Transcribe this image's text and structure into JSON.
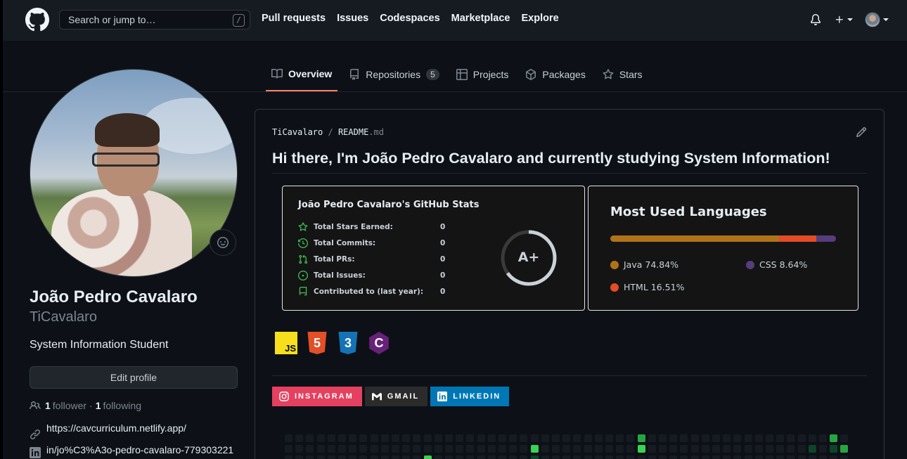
{
  "header": {
    "search_placeholder": "Search or jump to…",
    "search_shortcut": "/",
    "nav": [
      "Pull requests",
      "Issues",
      "Codespaces",
      "Marketplace",
      "Explore"
    ]
  },
  "tabs": [
    {
      "label": "Overview",
      "icon": "book-icon"
    },
    {
      "label": "Repositories",
      "icon": "repo-icon",
      "count": "5"
    },
    {
      "label": "Projects",
      "icon": "table-icon"
    },
    {
      "label": "Packages",
      "icon": "package-icon"
    },
    {
      "label": "Stars",
      "icon": "star-icon"
    }
  ],
  "profile": {
    "name": "João Pedro Cavalaro",
    "login": "TiCavalaro",
    "bio": "System Information Student",
    "edit_label": "Edit profile",
    "followers": "1",
    "followers_label": "follower",
    "separator": "·",
    "following": "1",
    "following_label": "following",
    "website": "https://cavcurriculum.netlify.app/",
    "linkedin": "in/jo%C3%A3o-pedro-cavalaro-779303221"
  },
  "readme": {
    "path_owner": "TiCavalaro",
    "path_sep": "/",
    "path_file": "README",
    "path_ext": ".md",
    "title": "Hi there, I'm João Pedro Cavalaro and currently studying System Information!"
  },
  "stats_card": {
    "title": "João Pedro Cavalaro's GitHub Stats",
    "rows": [
      {
        "label": "Total Stars Earned:",
        "value": "0",
        "icon": "star-outline-icon"
      },
      {
        "label": "Total Commits:",
        "value": "0",
        "icon": "history-icon"
      },
      {
        "label": "Total PRs:",
        "value": "0",
        "icon": "pull-request-icon"
      },
      {
        "label": "Total Issues:",
        "value": "0",
        "icon": "issue-icon"
      },
      {
        "label": "Contributed to (last year):",
        "value": "0",
        "icon": "repo-book-icon"
      }
    ],
    "grade": "A+",
    "grade_ring_fraction": 0.65,
    "accent": "#3fb950"
  },
  "languages_card": {
    "title": "Most Used Languages",
    "langs": [
      {
        "name": "Java",
        "percent": "74.84%",
        "value": 74.84,
        "color": "#b07219"
      },
      {
        "name": "CSS",
        "percent": "8.64%",
        "value": 8.64,
        "color": "#563d7c"
      },
      {
        "name": "HTML",
        "percent": "16.51%",
        "value": 16.51,
        "color": "#e34c26"
      }
    ]
  },
  "tech_icons": [
    {
      "name": "javascript-icon",
      "text": "JS",
      "bg": "#f7df1e",
      "fg": "#000000"
    },
    {
      "name": "html5-icon",
      "text": "5",
      "bg": "#e34f26",
      "fg": "#ffffff"
    },
    {
      "name": "css3-icon",
      "text": "3",
      "bg": "#1572b6",
      "fg": "#ffffff"
    },
    {
      "name": "csharp-icon",
      "text": "C",
      "bg": "#68217a",
      "fg": "#ffffff"
    }
  ],
  "badges": [
    {
      "label": "INSTAGRAM",
      "bg": "#e4405f",
      "icon": "instagram-icon"
    },
    {
      "label": "GMAIL",
      "bg": "#2b2b2b",
      "icon": "gmail-icon"
    },
    {
      "label": "LINKEDIN",
      "bg": "#0077b5",
      "icon": "linkedin-icon"
    }
  ],
  "colors": {
    "bg": "#0d1117",
    "header_bg": "#161b22",
    "tab_underline": "#f78166",
    "graph_empty": "#161b22",
    "graph_l1": "#0e4429",
    "graph_l3": "#26a641",
    "graph_l4": "#39d353"
  }
}
